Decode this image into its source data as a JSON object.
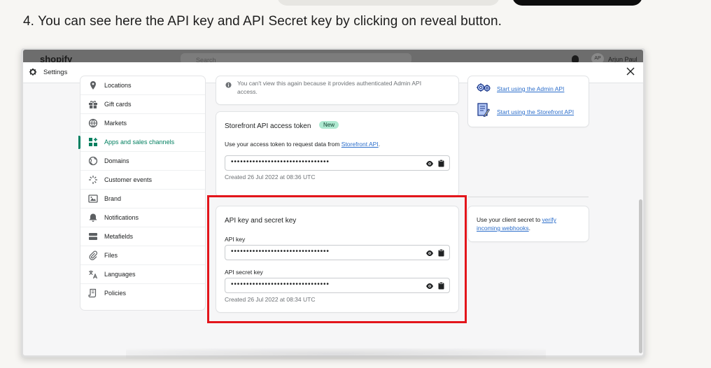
{
  "instruction": "4. You can see here the API key and API Secret key by clicking on reveal button.",
  "admin_topbar": {
    "logo": "shopify",
    "search_placeholder": "Search",
    "avatar_initials": "AP",
    "user_name": "Arjun Paul"
  },
  "settings_header": {
    "title": "Settings",
    "icons": {
      "gear": "gear-icon",
      "close": "close-icon"
    }
  },
  "sidebar": {
    "items": [
      {
        "label": "Locations",
        "icon": "location-pin-icon",
        "active": false
      },
      {
        "label": "Gift cards",
        "icon": "gift-icon",
        "active": false
      },
      {
        "label": "Markets",
        "icon": "globe-icon",
        "active": false
      },
      {
        "label": "Apps and sales channels",
        "icon": "apps-icon",
        "active": true
      },
      {
        "label": "Domains",
        "icon": "domain-globe-icon",
        "active": false
      },
      {
        "label": "Customer events",
        "icon": "sparkle-icon",
        "active": false
      },
      {
        "label": "Brand",
        "icon": "brand-icon",
        "active": false
      },
      {
        "label": "Notifications",
        "icon": "bell-icon",
        "active": false
      },
      {
        "label": "Metafields",
        "icon": "metafields-icon",
        "active": false
      },
      {
        "label": "Files",
        "icon": "paperclip-icon",
        "active": false
      },
      {
        "label": "Languages",
        "icon": "translate-icon",
        "active": false
      },
      {
        "label": "Policies",
        "icon": "policy-icon",
        "active": false
      }
    ]
  },
  "admin_token_card": {
    "note_line1": "You can't view this again because it provides authenticated Admin API",
    "note_line2": "access."
  },
  "storefront_card": {
    "title": "Storefront API access token",
    "badge": "New",
    "description_prefix": "Use your access token to request data from ",
    "description_link": "Storefront API",
    "description_suffix": ".",
    "token_masked": "••••••••••••••••••••••••••••••••",
    "created": "Created 26 Jul 2022 at 08:36 UTC"
  },
  "api_key_card": {
    "title": "API key and secret key",
    "api_key_label": "API key",
    "api_key_masked": "••••••••••••••••••••••••••••••••",
    "secret_label": "API secret key",
    "secret_masked": "••••••••••••••••••••••••••••••••",
    "created": "Created 26 Jul 2022 at 08:34 UTC"
  },
  "right_links_card": {
    "admin_link": "Start using the Admin API",
    "storefront_link": "Start using the Storefront API"
  },
  "client_secret_card": {
    "text_prefix": "Use your client secret to ",
    "link": "verify incoming webhooks",
    "link_line1": "verify",
    "link_line2": "incoming webhooks",
    "text_suffix": "."
  },
  "colors": {
    "highlight": "#e3151b",
    "active_nav": "#007f5f",
    "link": "#2c6ecb",
    "badge_bg": "#aee9d1"
  }
}
